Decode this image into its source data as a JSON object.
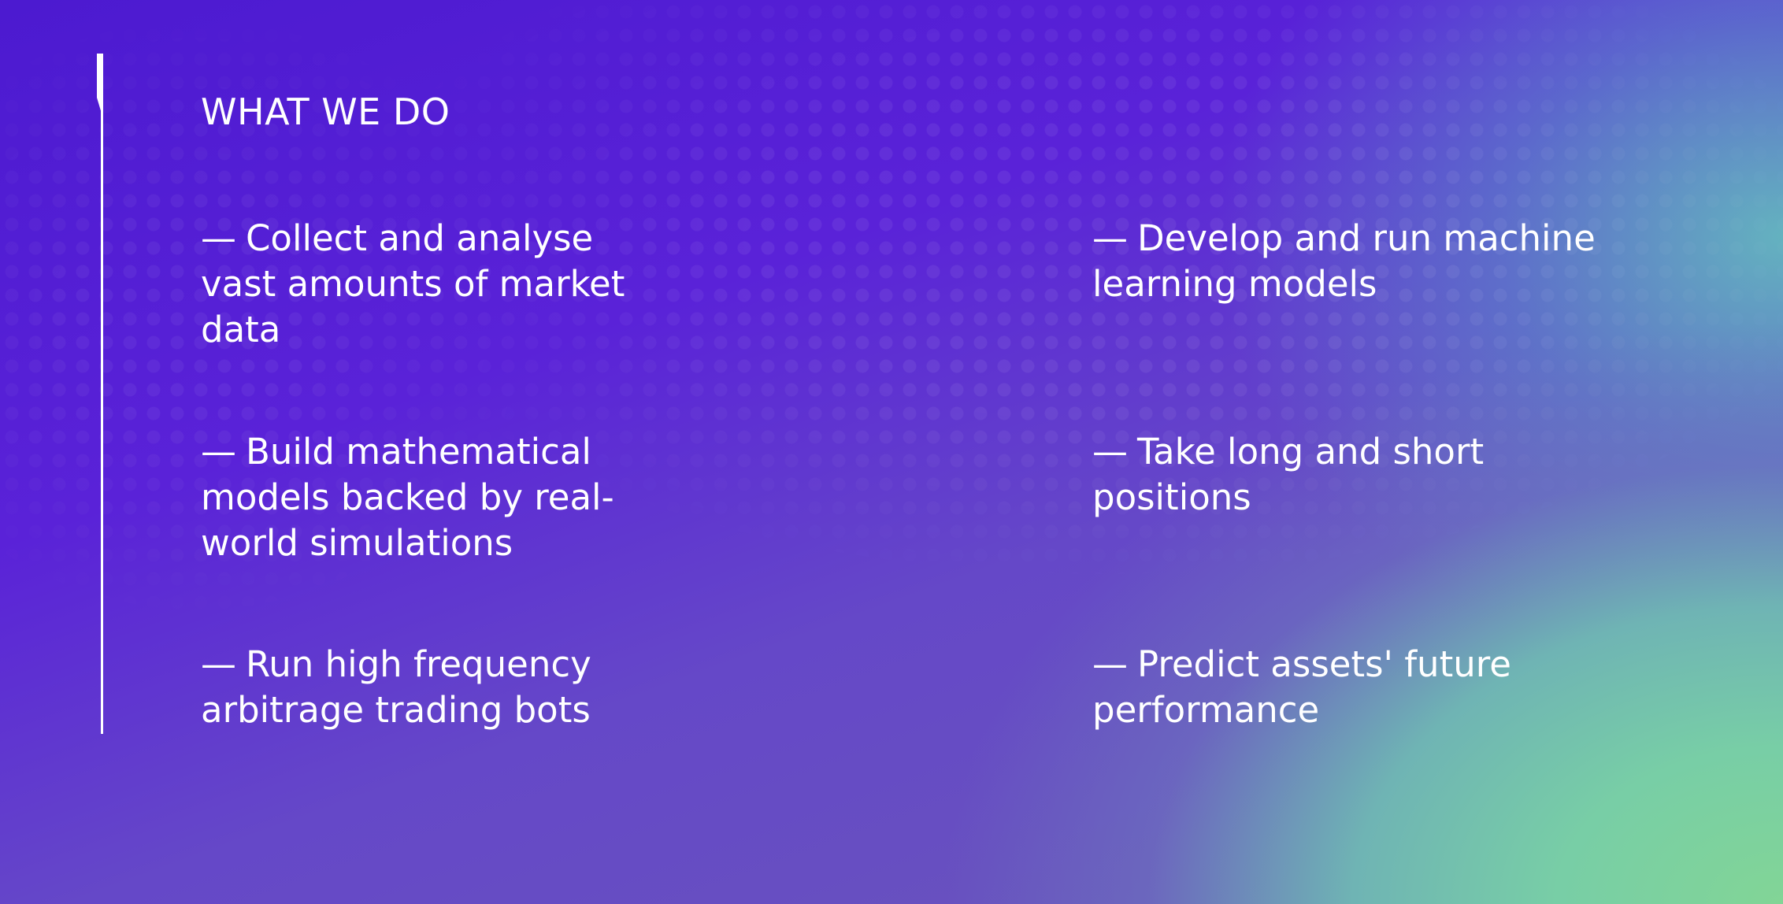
{
  "section": {
    "title": "WHAT WE DO"
  },
  "items": {
    "dash": "—",
    "left": [
      "Collect and analyse vast amounts of market data",
      "Build mathematical models backed by real-world simulations",
      "Run high frequency arbitrage trading bots"
    ],
    "right": [
      "Develop and run machine learning models",
      "Take long and short positions",
      "Predict assets' future performance"
    ]
  },
  "colors": {
    "background_top_left": "#4c1ad0",
    "background_bottom_right": "#82d596",
    "text": "#ffffff",
    "accent_line": "#ffffff"
  }
}
